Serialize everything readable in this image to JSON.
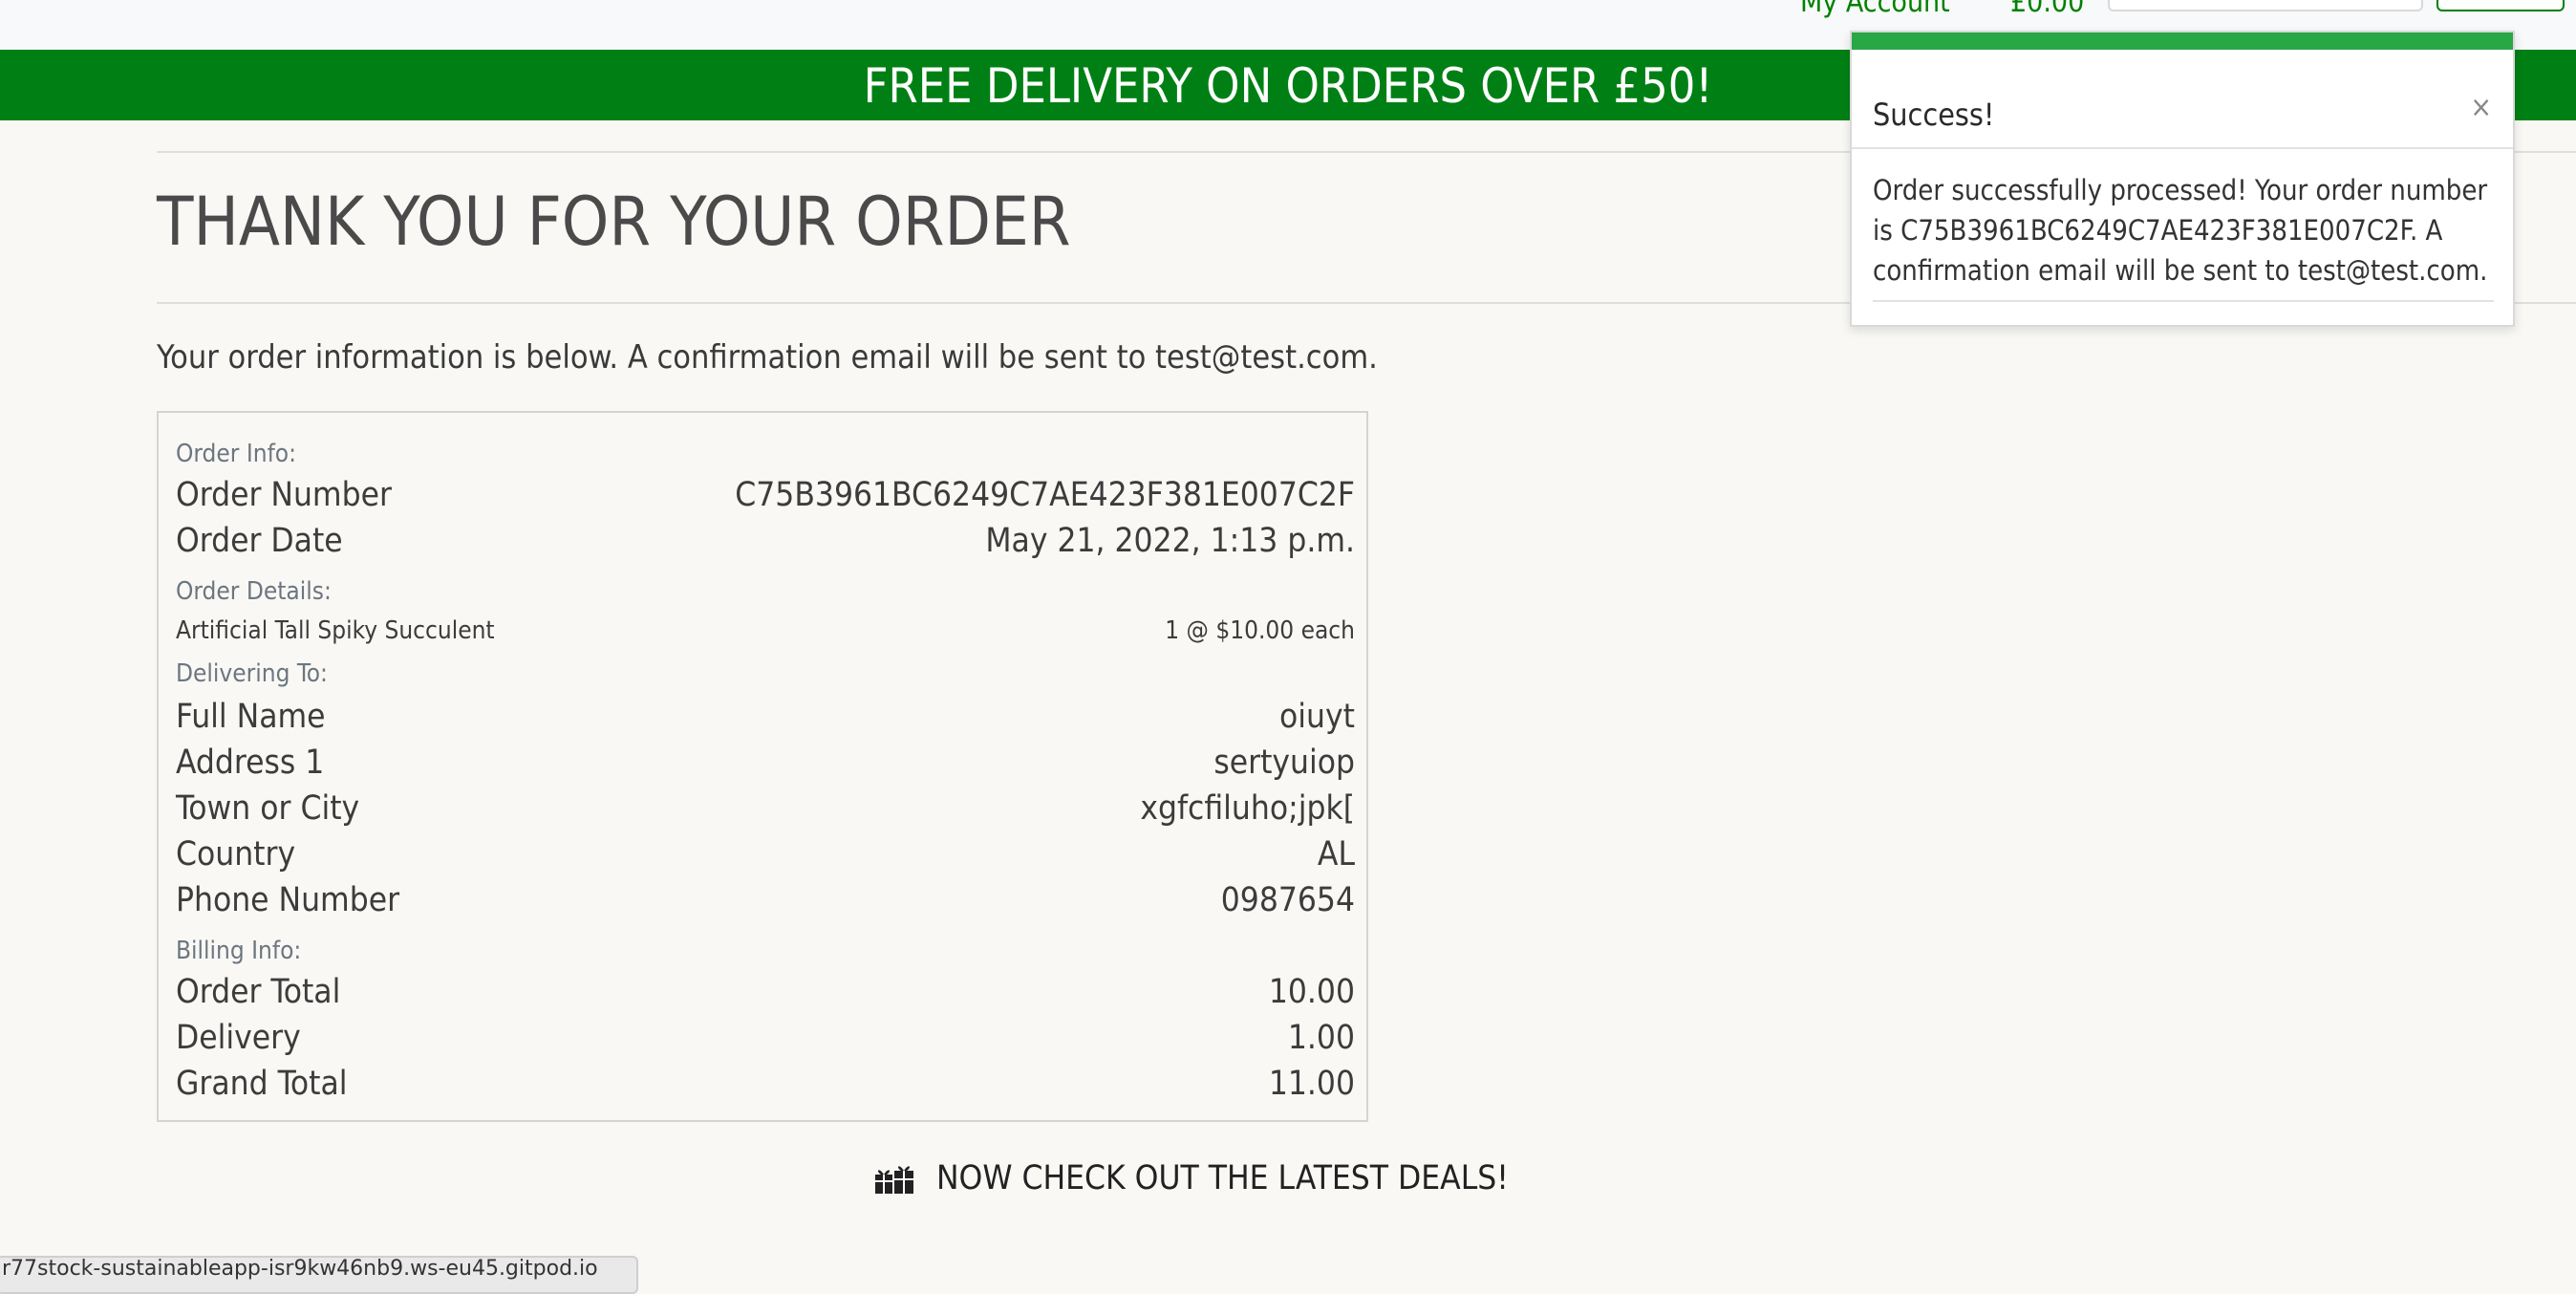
{
  "header": {
    "account_label": "My Account",
    "basket_total": "£0.00"
  },
  "banner": {
    "text": "FREE DELIVERY ON ORDERS OVER £50!"
  },
  "page": {
    "title": "THANK YOU FOR YOUR ORDER",
    "intro": "Your order information is below. A confirmation email will be sent to test@test.com."
  },
  "order": {
    "order_info_heading": "Order Info:",
    "order_number_label": "Order Number",
    "order_number": "C75B3961BC6249C7AE423F381E007C2F",
    "order_date_label": "Order Date",
    "order_date": "May 21, 2022, 1:13 p.m.",
    "order_details_heading": "Order Details:",
    "items": [
      {
        "name": "Artificial Tall Spiky Succulent",
        "qty_price": "1 @ $10.00 each"
      }
    ],
    "delivering_heading": "Delivering To:",
    "full_name_label": "Full Name",
    "full_name": "oiuyt",
    "address1_label": "Address 1",
    "address1": "sertyuiop",
    "town_label": "Town or City",
    "town": "xgfcfiluho;jpk[",
    "country_label": "Country",
    "country": "AL",
    "phone_label": "Phone Number",
    "phone": "0987654",
    "billing_heading": "Billing Info:",
    "order_total_label": "Order Total",
    "order_total": "10.00",
    "delivery_label": "Delivery",
    "delivery": "1.00",
    "grand_total_label": "Grand Total",
    "grand_total": "11.00"
  },
  "deals": {
    "label": "NOW CHECK OUT THE LATEST DEALS!",
    "icon": "gifts-icon"
  },
  "toast": {
    "title": "Success!",
    "close": "×",
    "message": "Order successfully processed! Your order number is C75B3961BC6249C7AE423F381E007C2F. A confirmation email will be sent to test@test.com."
  },
  "status_bar": {
    "url": "r77stock-sustainableapp-isr9kw46nb9.ws-eu45.gitpod.io"
  },
  "colors": {
    "brand_green": "#008014",
    "toast_accent": "#28a745",
    "header_link": "#008000"
  }
}
